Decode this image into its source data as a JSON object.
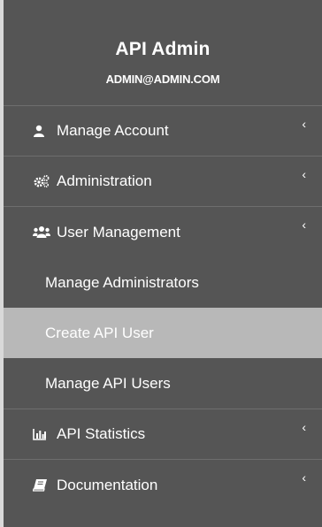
{
  "header": {
    "title": "API Admin",
    "email": "ADMIN@ADMIN.COM"
  },
  "menu": {
    "manage_account": {
      "label": "Manage Account",
      "icon": "user-icon"
    },
    "administration": {
      "label": "Administration",
      "icon": "cogs-icon"
    },
    "user_management": {
      "label": "User Management",
      "icon": "users-icon",
      "children": [
        {
          "label": "Manage Administrators"
        },
        {
          "label": "Create API User",
          "active": true
        },
        {
          "label": "Manage API Users"
        }
      ]
    },
    "api_statistics": {
      "label": "API Statistics",
      "icon": "bar-chart-icon"
    },
    "documentation": {
      "label": "Documentation",
      "icon": "book-icon"
    }
  },
  "chevron": "‹",
  "colors": {
    "sidebar_bg": "#555555",
    "active_bg": "#b8b8b8",
    "text": "#ffffff"
  }
}
